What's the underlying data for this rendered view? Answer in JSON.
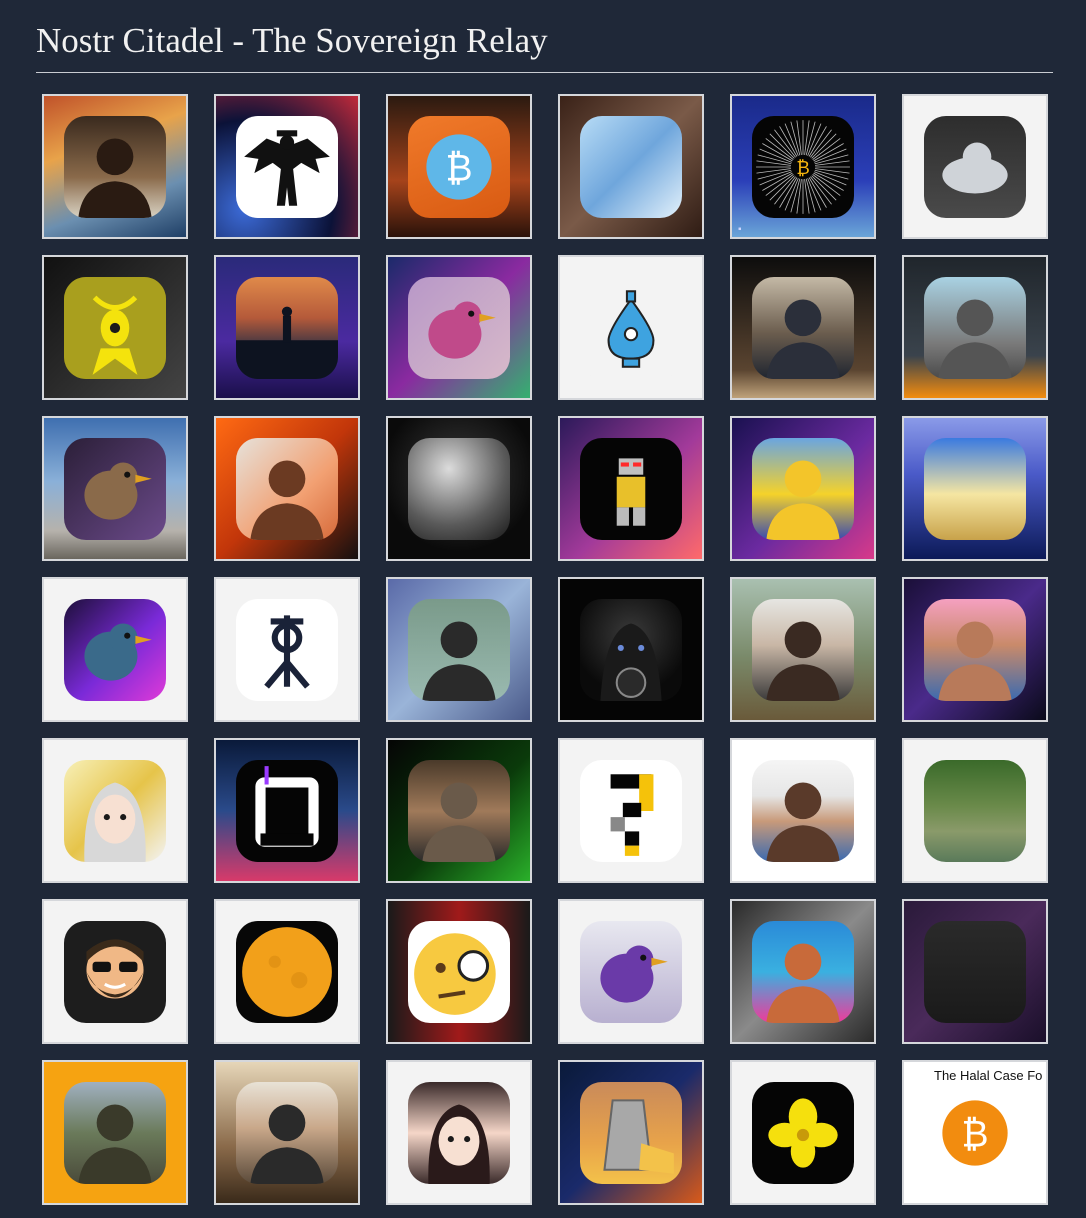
{
  "page": {
    "title": "Nostr Citadel - The Sovereign Relay"
  },
  "tiles": [
    {
      "icon": "man-with-camera-icon",
      "bg": "linear-gradient(160deg,#c0522a 0%,#e8a34a 35%,#6b8fb0 70%,#1f3f66 100%)",
      "av": "linear-gradient(180deg,#3a2a1e,#8a6a4a 60%,#d9d3c4)",
      "sym": "person",
      "c": "#2a1b12"
    },
    {
      "icon": "bat-winged-man-icon",
      "bg": "radial-gradient(circle at 20% 80%,#3c6bd8,#0b1238 55%,#c22a3a 100%)",
      "av": "#ffffff",
      "sym": "bat",
      "c": "#111111"
    },
    {
      "icon": "bitcoin-mascot-icon",
      "bg": "linear-gradient(180deg,#2b1a10,#a5431b 60%,#2a120a)",
      "av": "linear-gradient(160deg,#f07a2a,#d85a12)",
      "sym": "coin",
      "c": "#5fb7e8"
    },
    {
      "icon": "abstract-crystal-icon",
      "bg": "linear-gradient(135deg,#3a2218,#7a5a48 50%,#2f1c14)",
      "av": "linear-gradient(135deg,#b8dcf6,#6fa6dc 50%,#e3f1fb)",
      "sym": "none",
      "c": "#ffffff"
    },
    {
      "icon": "bitcoin-burst-icon",
      "bg": "linear-gradient(180deg,#1a2a8a,#2b3fb8 60%,#6aa5d8)",
      "av": "#050505",
      "sym": "burst",
      "c": "#f5b50f",
      "wm": true
    },
    {
      "icon": "white-cat-icon",
      "bg": "#f3f3f3",
      "av": "linear-gradient(180deg,#2d2d2d,#4a4a4a)",
      "sym": "blob",
      "c": "#cfd3d8"
    },
    {
      "icon": "yellow-bee-icon",
      "bg": "linear-gradient(135deg,#111,#444)",
      "av": "#f4e30d",
      "sym": "bee",
      "c": "#1b1b1b"
    },
    {
      "icon": "sunset-silhouette-icon",
      "bg": "linear-gradient(180deg,#2a2a7a,#4b2aa0 60%,#1a0f4a)",
      "av": "linear-gradient(180deg,#e08a4a,#b55a3a 40%,#1d2b45 75%)",
      "sym": "silhouette",
      "c": "#0d1320"
    },
    {
      "icon": "pink-bird-icon",
      "bg": "linear-gradient(135deg,#1b2a6a,#8a2aa0 50%,#35b070)",
      "av": "linear-gradient(135deg,#b898c8,#d7b9c9)",
      "sym": "bird",
      "c": "#c04a8a"
    },
    {
      "icon": "blue-robot-icon",
      "bg": "#f3f3f3",
      "av": "#f3f3f3",
      "sym": "drop",
      "c": "#3ea3e0"
    },
    {
      "icon": "man-red-eyes-icon",
      "bg": "linear-gradient(180deg,#0d0d0d,#5a4430 80%,#bfa27a)",
      "av": "linear-gradient(180deg,#c4b9a6,#6b5d4e 55%,#1f2530)",
      "sym": "person",
      "c": "#2b2f3a"
    },
    {
      "icon": "buddha-statue-icon",
      "bg": "linear-gradient(180deg,#20262c,#3a434c 70%,#f28c0f)",
      "av": "linear-gradient(180deg,#a9d2e3,#7a7a7a 65%,#4a4a4a)",
      "sym": "person",
      "c": "#555555"
    },
    {
      "icon": "vulture-gear-icon",
      "bg": "linear-gradient(180deg,#3f6fb0,#8ab0d8 45%,#b6b2ac 80%,#6a665e)",
      "av": "linear-gradient(135deg,#2b1f38,#6b4a8a)",
      "sym": "bird",
      "c": "#8a6a4a"
    },
    {
      "icon": "man-glowing-eyes-icon",
      "bg": "linear-gradient(135deg,#ff6a13,#c2360a 50%,#141010)",
      "av": "linear-gradient(135deg,#e6e2db,#f2a072 60%,#d66a3a)",
      "sym": "person",
      "c": "#6b3a22"
    },
    {
      "icon": "astronaut-icon",
      "bg": "radial-gradient(circle at 50% 40%,#3a3a3a,#0a0a0a 70%)",
      "av": "radial-gradient(circle at 40% 30%,#dcdcdc,#5a5a5a 60%,#1a1a1a)",
      "sym": "none",
      "c": "#ffffff"
    },
    {
      "icon": "lego-robot-icon",
      "bg": "linear-gradient(135deg,#2c1a5a,#a23a9a 55%,#ff6a6a)",
      "av": "#050505",
      "sym": "robot",
      "c": "#e8c02a"
    },
    {
      "icon": "homer-king-icon",
      "bg": "linear-gradient(135deg,#1a1150,#6b2aa0 55%,#d83a8a)",
      "av": "linear-gradient(180deg,#6aa5e0,#f5d22a 55%,#3a4ab0)",
      "sym": "person",
      "c": "#f3c52a"
    },
    {
      "icon": "dancing-person-icon",
      "bg": "linear-gradient(180deg,#8a9ae8,#4a5ac8 40%,#0c1a58)",
      "av": "linear-gradient(180deg,#3a7ae0,#f5e6a2 55%,#c8a24a)",
      "sym": "none",
      "c": "#ffffff"
    },
    {
      "icon": "purple-vulture-icon",
      "bg": "#f3f3f3",
      "av": "linear-gradient(135deg,#1d0f3a,#7a2ad8 55%,#e03ad8)",
      "sym": "bird",
      "c": "#3a6a8a"
    },
    {
      "icon": "rune-glyph-icon",
      "bg": "#f3f3f3",
      "av": "#ffffff",
      "sym": "rune",
      "c": "#1a2238"
    },
    {
      "icon": "man-sunglasses-icon",
      "bg": "linear-gradient(135deg,#5a6aa8,#9ab4d8 50%,#4a5a8a)",
      "av": "linear-gradient(180deg,#7a9a8a,#9abab0)",
      "sym": "person",
      "c": "#2a2a2a"
    },
    {
      "icon": "hooded-figure-icon",
      "bg": "#050505",
      "av": "radial-gradient(circle at 50% 35%,#3a3a3a,#0a0a0a 70%)",
      "sym": "hood",
      "c": "#6a8ad8"
    },
    {
      "icon": "young-man-icon",
      "bg": "linear-gradient(180deg,#a9c0b0,#7a8a6a 55%,#6a5a3a)",
      "av": "linear-gradient(180deg,#e6e6e2,#c9b7a6 45%,#3a3a3a)",
      "sym": "person",
      "c": "#3a2a22"
    },
    {
      "icon": "man-pink-cap-icon",
      "bg": "linear-gradient(135deg,#1a0f38,#4a2a8a 50%,#0a0a1a)",
      "av": "linear-gradient(180deg,#f5a0c0,#c98a6a 45%,#3a6ab0)",
      "sym": "person",
      "c": "#b87a5a"
    },
    {
      "icon": "anime-girl-icon",
      "bg": "#f3f3f3",
      "av": "linear-gradient(135deg,#f7f0b8,#e6c44a 50%,#f3f3f3)",
      "sym": "anime",
      "c": "#d8d8d8"
    },
    {
      "icon": "letter-n-icon",
      "bg": "linear-gradient(180deg,#0a1a3a,#2a4a8a 50%,#d83a6a)",
      "av": "#050505",
      "sym": "n",
      "c": "#ffffff"
    },
    {
      "icon": "man-matrix-icon",
      "bg": "linear-gradient(135deg,#050505,#0a3a0a 55%,#2ab02a)",
      "av": "linear-gradient(180deg,#4a3a2a,#a07a5a 50%,#2a2a2a)",
      "sym": "person",
      "c": "#6a5a4a"
    },
    {
      "icon": "pixel-question-icon",
      "bg": "#f3f3f3",
      "av": "#ffffff",
      "sym": "pixelq",
      "c": "#050505"
    },
    {
      "icon": "smiling-man-icon",
      "bg": "#ffffff",
      "av": "linear-gradient(180deg,#f5f5f5,#e6e6e6 35%,#c89a7a 60%,#3a6ab0)",
      "sym": "person",
      "c": "#5a3a2a"
    },
    {
      "icon": "jungle-river-icon",
      "bg": "#f3f3f3",
      "av": "linear-gradient(180deg,#3a6a2a,#6a8a4a 45%,#8a9a6a 70%,#5a7a5a)",
      "sym": "none",
      "c": "#ffffff"
    },
    {
      "icon": "bearded-emoji-icon",
      "bg": "#f3f3f3",
      "av": "#1d1d1d",
      "sym": "beard",
      "c": "#f0b886"
    },
    {
      "icon": "full-moon-icon",
      "bg": "#f3f3f3",
      "av": "#070707",
      "sym": "moon",
      "c": "#f2a01a"
    },
    {
      "icon": "monocle-emoji-icon",
      "bg": "linear-gradient(90deg,#1a1a1a,#a01a1a 50%,#1a1a1a)",
      "av": "#ffffff",
      "sym": "emoji",
      "c": "#f7c940"
    },
    {
      "icon": "purple-bird-icon",
      "bg": "#f3f3f3",
      "av": "linear-gradient(180deg,#e8e8f0,#b8b0d0)",
      "sym": "bird",
      "c": "#6a3aa8"
    },
    {
      "icon": "curly-hair-woman-icon",
      "bg": "linear-gradient(135deg,#2a2a2a,#8a8a8a 50%,#2a2a2a)",
      "av": "linear-gradient(180deg,#2a8ad8,#3ab0e0 50%,#f03a9a)",
      "sym": "person",
      "c": "#c86a3a"
    },
    {
      "icon": "dark-abstract-icon",
      "bg": "linear-gradient(135deg,#2a1a3a,#4a2a5a 50%,#1a0f2a)",
      "av": "linear-gradient(180deg,#2a2a2a,#1a1a1a)",
      "sym": "none",
      "c": "#bbbbbb"
    },
    {
      "icon": "man-forest-icon",
      "bg": "#f6a311",
      "av": "linear-gradient(180deg,#a0b0c0,#6a7a5a 50%,#4a4a3a)",
      "sym": "person",
      "c": "#3a3a2a"
    },
    {
      "icon": "man-glasses-icon",
      "bg": "linear-gradient(180deg,#e6d6b8,#8a6a4a 60%,#3a2a1a)",
      "av": "linear-gradient(180deg,#e8e2d6,#c9a88a 45%,#5a4a3a)",
      "sym": "person",
      "c": "#2a2a2a"
    },
    {
      "icon": "anime-girl-dark-hair-icon",
      "bg": "#f3f3f3",
      "av": "linear-gradient(180deg,#3a2a2a,#f5d6c8 50%,#3a2a2a)",
      "sym": "anime",
      "c": "#2a1a1a"
    },
    {
      "icon": "cheese-grater-icon",
      "bg": "linear-gradient(135deg,#0a1a3a,#1a2a6a 50%,#d85a1a)",
      "av": "linear-gradient(180deg,#c98a5a,#e8a34a 60%,#f3c24a)",
      "sym": "grater",
      "c": "#a8a8a8"
    },
    {
      "icon": "yellow-flower-icon",
      "bg": "#f3f3f3",
      "av": "#050505",
      "sym": "flower",
      "c": "#f5e00d"
    },
    {
      "icon": "halal-bitcoin-icon",
      "bg": "#ffffff",
      "av": "#ffffff",
      "sym": "coin",
      "c": "#f28c0f",
      "caption": "The Halal Case Fo"
    }
  ]
}
